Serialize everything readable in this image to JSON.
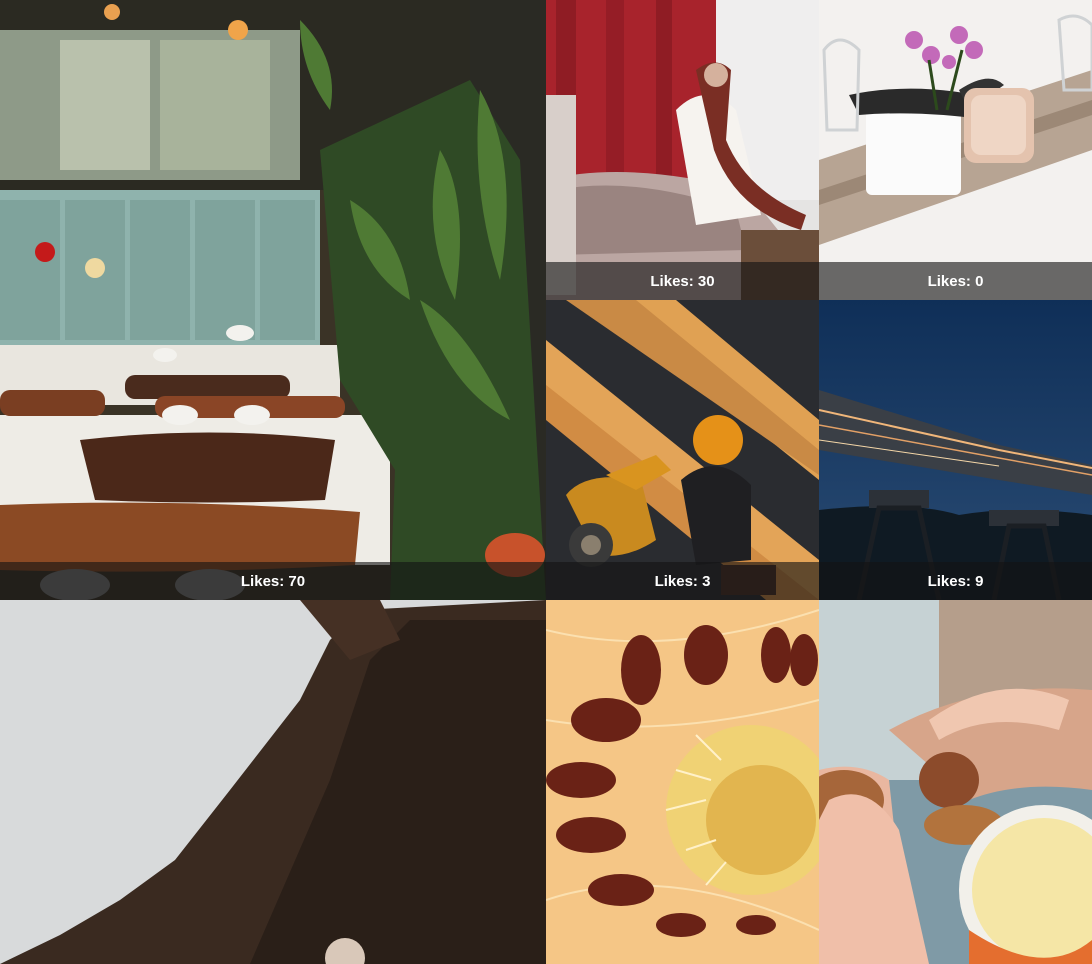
{
  "likes_label": "Likes",
  "photos": [
    {
      "subject": "restaurant-interior",
      "likes": "70"
    },
    {
      "subject": "woman-on-bed",
      "likes": "30"
    },
    {
      "subject": "orchid-bath-tray",
      "likes": "0"
    },
    {
      "subject": "scooter-rider",
      "likes": "3"
    },
    {
      "subject": "bridge-night",
      "likes": "9"
    },
    {
      "subject": "forest-sky",
      "likes": null
    },
    {
      "subject": "orange-flower",
      "likes": null
    },
    {
      "subject": "cookie-jar-hands",
      "likes": null
    }
  ]
}
